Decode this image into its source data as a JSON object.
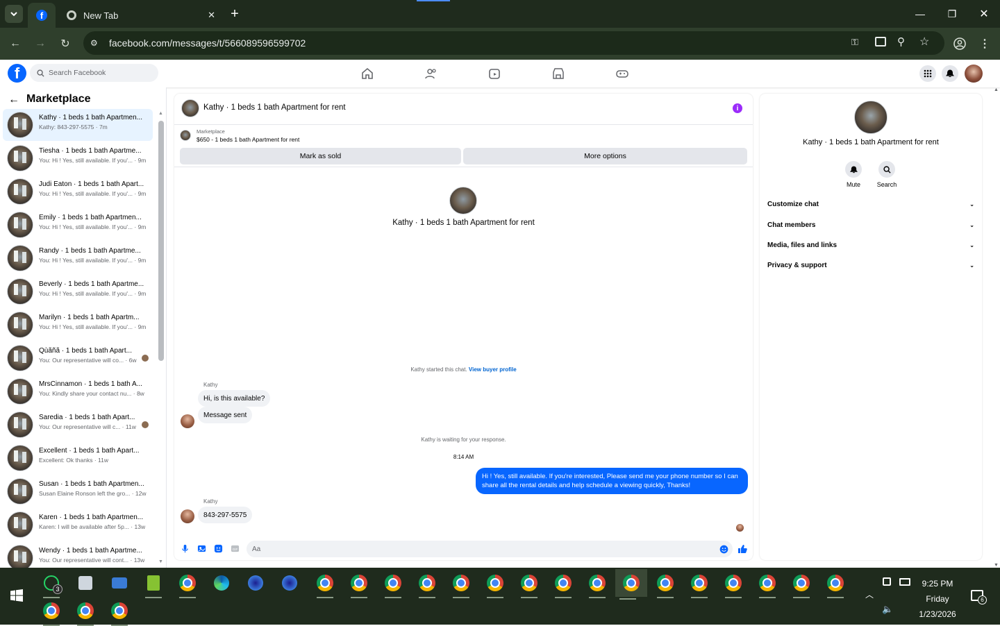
{
  "browser": {
    "tab_title": "New Tab",
    "url": "facebook.com/messages/t/566089596599702"
  },
  "fb": {
    "search_placeholder": "Search Facebook"
  },
  "sidebar": {
    "title": "Marketplace",
    "conversations": [
      {
        "title": "Kathy · 1 beds 1 bath Apartmen...",
        "preview": "Kathy: 843-297-5575 · 7m",
        "selected": true
      },
      {
        "title": "Tiesha · 1 beds 1 bath Apartme...",
        "preview": "You: Hi ! Yes, still available. If you'... · 9m"
      },
      {
        "title": "Judi Eaton · 1 beds 1 bath Apart...",
        "preview": "You: Hi ! Yes, still available. If you'... · 9m"
      },
      {
        "title": "Emily · 1 beds 1 bath Apartmen...",
        "preview": "You: Hi ! Yes, still available. If you'... · 9m"
      },
      {
        "title": "Randy · 1 beds 1 bath Apartme...",
        "preview": "You: Hi ! Yes, still available. If you'... · 9m"
      },
      {
        "title": "Beverly · 1 beds 1 bath Apartme...",
        "preview": "You: Hi ! Yes, still available. If you'... · 9m"
      },
      {
        "title": "Marilyn · 1 beds 1 bath Apartm...",
        "preview": "You: Hi ! Yes, still available. If you'... · 9m"
      },
      {
        "title": "Qùãñã · 1 beds 1 bath Apart...",
        "preview": "You: Our representative will co... · 6w",
        "dot": true
      },
      {
        "title": "MrsCinnamon · 1 beds 1 bath A...",
        "preview": "You: Kindly share your contact nu... · 8w"
      },
      {
        "title": "Saredia · 1 beds 1 bath Apart...",
        "preview": "You: Our representative will c... · 11w",
        "dot": true
      },
      {
        "title": "Excellent · 1 beds 1 bath Apart...",
        "preview": "Excellent: Ok thanks · 11w"
      },
      {
        "title": "Susan · 1 beds 1 bath Apartmen...",
        "preview": "Susan Elaine Ronson left the gro... · 12w"
      },
      {
        "title": "Karen · 1 beds 1 bath Apartmen...",
        "preview": "Karen: I will be available after 5p... · 13w"
      },
      {
        "title": "Wendy · 1 beds 1 bath Apartme...",
        "preview": "You: Our representative will cont... · 13w"
      }
    ]
  },
  "chat": {
    "title": "Kathy · 1 beds 1 bath Apartment for rent",
    "marketplace_label": "Marketplace",
    "listing": "$650 - 1 beds 1 bath Apartment for rent",
    "mark_sold": "Mark as sold",
    "more_options": "More options",
    "intro_name": "Kathy · 1 beds 1 bath Apartment for rent",
    "started_text": "Kathy started this chat.",
    "view_buyer": "View buyer profile",
    "sender1": "Kathy",
    "msg1": "Hi, is this available?",
    "msg2": "Message sent",
    "waiting": "Kathy is waiting for your response.",
    "time": "8:14 AM",
    "outgoing": "Hi ! Yes, still available. If you're interested, Please send me your phone number so I can share all the rental details and help schedule a viewing quickly, Thanks!",
    "sender2": "Kathy",
    "msg3": "843-297-5575",
    "composer_placeholder": "Aa"
  },
  "right_panel": {
    "name": "Kathy · 1 beds 1 bath Apartment for rent",
    "mute": "Mute",
    "search": "Search",
    "sections": [
      "Customize chat",
      "Chat members",
      "Media, files and links",
      "Privacy & support"
    ]
  },
  "taskbar": {
    "whatsapp_badge": "3",
    "time": "9:25 PM",
    "day": "Friday",
    "date": "1/23/2026",
    "notif_count": "6"
  }
}
